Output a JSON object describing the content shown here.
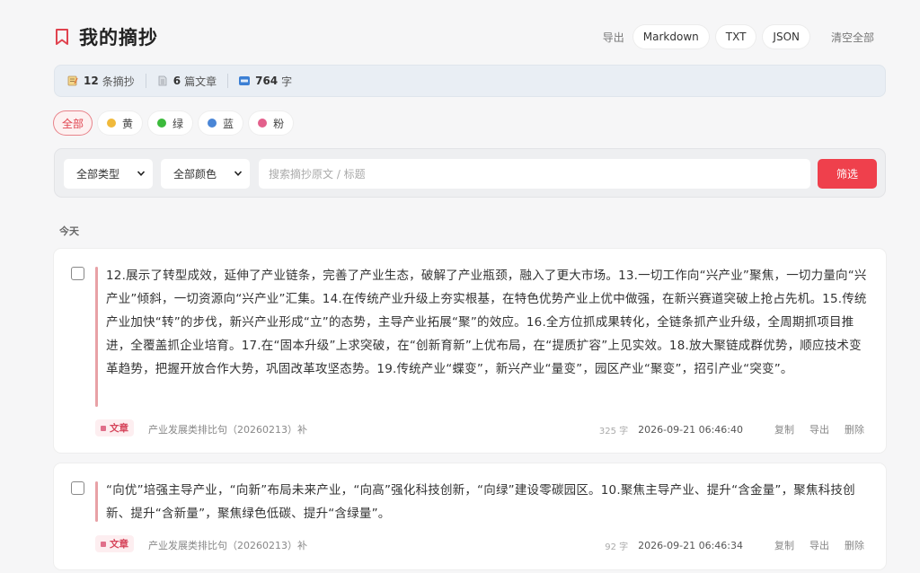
{
  "header": {
    "title": "我的摘抄",
    "export_label": "导出",
    "export_options": [
      "Markdown",
      "TXT",
      "JSON"
    ],
    "clear_label": "清空全部"
  },
  "stats": {
    "excerpts": {
      "count": "12",
      "unit": "条摘抄"
    },
    "articles": {
      "count": "6",
      "unit": "篇文章"
    },
    "chars": {
      "count": "764",
      "unit": "字"
    }
  },
  "color_filters": [
    {
      "label": "全部",
      "active": true
    },
    {
      "label": "黄",
      "color": "#f0b93b"
    },
    {
      "label": "绿",
      "color": "#3cba3c"
    },
    {
      "label": "蓝",
      "color": "#4a86d6"
    },
    {
      "label": "粉",
      "color": "#e3608c"
    }
  ],
  "filters": {
    "type_select": "全部类型",
    "color_select": "全部颜色",
    "search_placeholder": "搜索摘抄原文 / 标题",
    "submit_label": "筛选"
  },
  "day_label": "今天",
  "cards": [
    {
      "text": "12.展示了转型成效，延伸了产业链条，完善了产业生态，破解了产业瓶颈，融入了更大市场。13.一切工作向“兴产业”聚焦，一切力量向“兴产业”倾斜，一切资源向“兴产业”汇集。14.在传统产业升级上夯实根基，在特色优势产业上优中做强，在新兴赛道突破上抢占先机。15.传统产业加快“转”的步伐，新兴产业形成“立”的态势，主导产业拓展“聚”的效应。16.全方位抓成果转化，全链条抓产业升级，全周期抓项目推进，全覆盖抓企业培育。17.在“固本升级”上求突破，在“创新育新”上优布局，在“提质扩容”上见实效。18.放大聚链成群优势，顺应技术变革趋势，把握开放合作大势，巩固改革攻坚态势。19.传统产业“蝶变”，新兴产业“量变”，园区产业“聚变”，招引产业“突变”。",
      "tag": "文章",
      "source": "产业发展类排比句（20260213）补",
      "count": "325 字",
      "time": "2026-09-21 06:46:40",
      "actions": [
        "复制",
        "导出",
        "删除"
      ]
    },
    {
      "text": "“向优”培强主导产业，“向新”布局未来产业，“向高”强化科技创新，“向绿”建设零碳园区。10.聚焦主导产业、提升“含金量”，聚焦科技创新、提升“含新量”，聚焦绿色低碳、提升“含绿量”。",
      "tag": "文章",
      "source": "产业发展类排比句（20260213）补",
      "count": "92 字",
      "time": "2026-09-21 06:46:34",
      "actions": [
        "复制",
        "导出",
        "删除"
      ]
    }
  ],
  "colors": {
    "accent": "#ef404c",
    "quote_bar": "#e8a1a6",
    "tag_text": "#d6455b"
  }
}
